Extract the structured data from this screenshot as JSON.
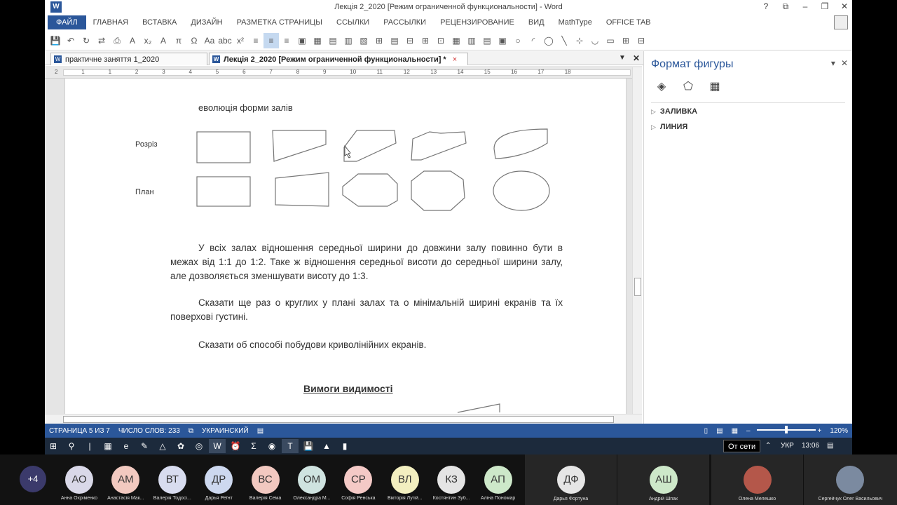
{
  "window": {
    "title": "Лекція 2_2020 [Режим ограниченной функциональности] - Word",
    "app_icon": "W",
    "controls": [
      "?",
      "⧉",
      "–",
      "❐",
      "✕"
    ]
  },
  "ribbon": {
    "tabs": [
      "ФАЙЛ",
      "ГЛАВНАЯ",
      "ВСТАВКА",
      "ДИЗАЙН",
      "РАЗМЕТКА СТРАНИЦЫ",
      "ССЫЛКИ",
      "РАССЫЛКИ",
      "РЕЦЕНЗИРОВАНИЕ",
      "ВИД",
      "MathType",
      "OFFICE TAB"
    ]
  },
  "toolbar": {
    "items": [
      "💾",
      "↶",
      "↻",
      "⇄",
      "⎙",
      "A",
      "x₂",
      "A",
      "π",
      "Ω",
      "Aa",
      "abc",
      "x²",
      "≡",
      "≡",
      "≡",
      "▣",
      "▦",
      "▤",
      "▥",
      "▧",
      "⊞",
      "▤",
      "⊟",
      "⊞",
      "⊡",
      "▦",
      "▥",
      "▤",
      "▣",
      "○",
      "◜",
      "◯",
      "╲",
      "⊹",
      "◡",
      "▭",
      "⊞",
      "⊟"
    ],
    "active_index": 14
  },
  "doc_tabs": {
    "tab1": "практичне заняття 1_2020",
    "tab2": "Лекція 2_2020 [Режим ограниченной функциональности] *",
    "close": "×"
  },
  "ruler": {
    "numbers": [
      "2",
      "1",
      "1",
      "2",
      "3",
      "4",
      "5",
      "6",
      "7",
      "8",
      "9",
      "10",
      "11",
      "12",
      "13",
      "14",
      "15",
      "16",
      "17",
      "18"
    ]
  },
  "document": {
    "heading": "еволюція форми залів",
    "row1_label": "Розріз",
    "row2_label": "План",
    "para1": "У всіх залах відношення середньої ширини до довжини залу повинно бути в межах від 1:1 до 1:2. Таке ж відношення середньої висоти до середньої ширини залу, але дозволяється  зменшувати висоту до 1:3.",
    "para2": "Сказати ще раз о круглих у плані залах та о мінімальній ширині екранів та їх поверхові густині.",
    "para3": "Сказати об способі побудови криволінійних екранів.",
    "section_title": "Вимоги видимості"
  },
  "format_pane": {
    "title": "Формат фигуры",
    "sections": [
      "ЗАЛИВКА",
      "ЛИНИЯ"
    ],
    "icons": [
      "fill-bucket-icon",
      "pentagon-icon",
      "size-layout-icon"
    ]
  },
  "status": {
    "page": "СТРАНИЦА 5 ИЗ 7",
    "words": "ЧИСЛО СЛОВ: 233",
    "language": "УКРАИНСКИЙ",
    "zoom": "120%"
  },
  "taskbar": {
    "tooltip": "От сети",
    "lang": "УКР",
    "time": "13:06"
  },
  "participants": {
    "more": "+4",
    "list": [
      {
        "initials": "АО",
        "name": "Анна Охріменко",
        "color": "#d9d8e8"
      },
      {
        "initials": "АМ",
        "name": "Анастасія Мак...",
        "color": "#f2c9c0"
      },
      {
        "initials": "ВТ",
        "name": "Валерія Тодосі...",
        "color": "#d8dcef"
      },
      {
        "initials": "ДР",
        "name": "Дарья Реїнт",
        "color": "#cdd8ef"
      },
      {
        "initials": "ВС",
        "name": "Валерія Сема",
        "color": "#f2c8c0"
      },
      {
        "initials": "ОМ",
        "name": "Олександра М...",
        "color": "#cfe3e0"
      },
      {
        "initials": "СР",
        "name": "Софія Ренська",
        "color": "#f4c9c6"
      },
      {
        "initials": "ВЛ",
        "name": "Вікторія Лугій...",
        "color": "#f3efc0"
      },
      {
        "initials": "КЗ",
        "name": "Костянтин Зуб...",
        "color": "#e4e4e4"
      },
      {
        "initials": "АП",
        "name": "Аліна Пономар",
        "color": "#cde8c9"
      }
    ],
    "tiles": [
      {
        "initials": "ДФ",
        "name": "Дарья Фортуна",
        "color": "#e6e6e6"
      },
      {
        "initials": "АШ",
        "name": "Андрій Шпак",
        "color": "#cde8c9"
      },
      {
        "initials": "",
        "name": "Олена Мелешко",
        "color": "#b4574a"
      },
      {
        "initials": "",
        "name": "Сергейчук Олег Васильович",
        "color": "#7b8aa0"
      }
    ]
  }
}
